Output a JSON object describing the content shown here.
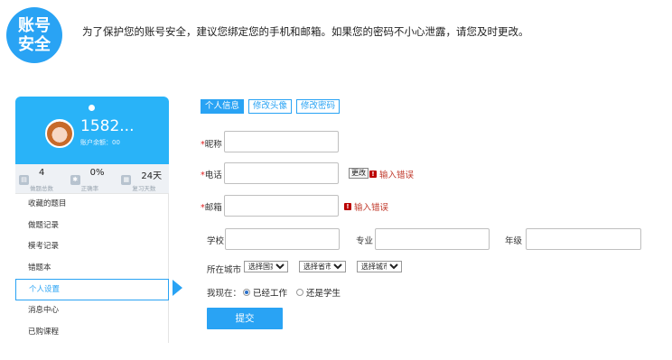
{
  "security": {
    "badge": "账号安全",
    "notice": "为了保护您的账号安全，建议您绑定您的手机和邮箱。如果您的密码不小心泄露，请您及时更改。"
  },
  "profile": {
    "username": "1582...",
    "balance": "账户余额：00"
  },
  "stats": [
    {
      "value": "4",
      "label": "做题总数",
      "icon": "doc-icon"
    },
    {
      "value": "0%",
      "label": "正确率",
      "icon": "gear-icon"
    },
    {
      "value": "24天",
      "label": "复习天数",
      "icon": "calendar-icon"
    }
  ],
  "menu": [
    {
      "label": "收藏的题目"
    },
    {
      "label": "做题记录"
    },
    {
      "label": "模考记录"
    },
    {
      "label": "错题本"
    },
    {
      "label": "个人设置"
    },
    {
      "label": "消息中心"
    },
    {
      "label": "已购课程"
    }
  ],
  "tabs": [
    "个人信息",
    "修改头像",
    "修改密码"
  ],
  "form": {
    "nickname_label": "昵称",
    "phone_label": "电话",
    "email_label": "邮箱",
    "required_mark": "*",
    "change_btn": "更改",
    "error_text": "输入错误",
    "school_label": "学校",
    "major_label": "专业",
    "grade_label": "年级",
    "city_label": "所在城市",
    "country_select": "选择国家",
    "province_select": "选择省市",
    "city_select": "选择城市",
    "status_label": "我现在：",
    "status_option1": "已经工作",
    "status_option2": "还是学生",
    "submit": "提交"
  },
  "colors": {
    "accent": "#29a3f4",
    "error": "#c0392b"
  }
}
